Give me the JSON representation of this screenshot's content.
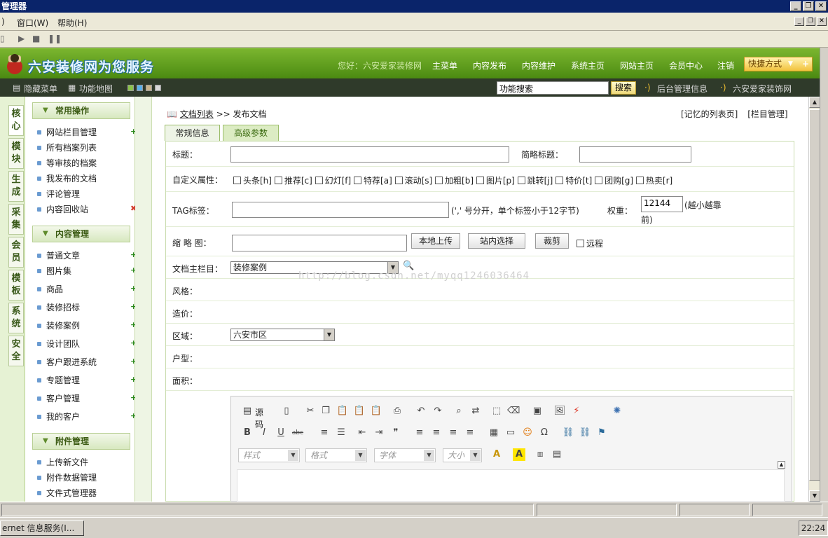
{
  "window": {
    "title": "管理器"
  },
  "menubar": {
    "items": [
      "窗口(W)",
      "帮助(H)"
    ],
    "left_fragment": ")"
  },
  "header": {
    "logo": "六安装修网为您服务",
    "welcome": "您好：六安爱家装修网",
    "nav": [
      "主菜单",
      "内容发布",
      "内容维护",
      "系统主页",
      "网站主页",
      "会员中心",
      "注销"
    ],
    "shortcut": "快捷方式"
  },
  "subbar": {
    "hide_menu": "隐藏菜单",
    "func_map": "功能地图",
    "search_value": "功能搜索",
    "search_button": "搜索",
    "admin_info": "后台管理信息",
    "site_name": "六安爱家装饰网"
  },
  "vtabs": [
    "核心",
    "模块",
    "生成",
    "采集",
    "会员",
    "模板",
    "系统",
    "安全"
  ],
  "leftmenu": {
    "sections": [
      {
        "title": "常用操作",
        "items": [
          "网站栏目管理",
          "所有档案列表",
          "等审核的档案",
          "我发布的文档",
          "评论管理",
          "内容回收站"
        ]
      },
      {
        "title": "内容管理",
        "items": [
          "普通文章",
          "图片集",
          "商品",
          "装修招标",
          "装修案例",
          "设计团队",
          "客户跟进系统",
          "专题管理",
          "客户管理",
          "我的客户"
        ]
      },
      {
        "title": "附件管理",
        "items": [
          "上传新文件",
          "附件数据管理",
          "文件式管理器"
        ]
      }
    ]
  },
  "main": {
    "breadcrumb_link": "文档列表",
    "breadcrumb_current": ">> 发布文档",
    "right_links": [
      "[记忆的列表页]",
      "[栏目管理]"
    ],
    "tabs": [
      "常规信息",
      "高级参数"
    ],
    "form": {
      "title_label": "标题：",
      "short_title_label": "简略标题：",
      "attr_label": "自定义属性：",
      "attrs": [
        "头条[h]",
        "推荐[c]",
        "幻灯[f]",
        "特荐[a]",
        "滚动[s]",
        "加粗[b]",
        "图片[p]",
        "跳转[j]",
        "特价[t]",
        "团购[g]",
        "热卖[r]"
      ],
      "tag_label": "TAG标签：",
      "tag_hint": "(',' 号分开，单个标签小于12字节)",
      "weight_label": "权重：",
      "weight_value": "12144",
      "weight_hint_1": "(越小越靠",
      "weight_hint_2": "前)",
      "thumb_label": "缩 略 图：",
      "upload_local": "本地上传",
      "select_site": "站内选择",
      "crop": "裁剪",
      "remote": "远程",
      "main_column_label": "文档主栏目：",
      "main_column_value": "装修案例",
      "style_label": "风格：",
      "price_label": "造价：",
      "area_label": "区域：",
      "area_value": "六安市区",
      "layout_label": "户型：",
      "size_label": "面积："
    },
    "editor": {
      "source": "源码",
      "style_drop": "样式",
      "format_drop": "格式",
      "font_drop": "字体",
      "size_drop": "大小"
    },
    "watermark": "http://blog.csdn.net/myqq1246036464"
  },
  "taskbar": {
    "task": "ernet 信息服务(I...",
    "clock": "22:24"
  }
}
